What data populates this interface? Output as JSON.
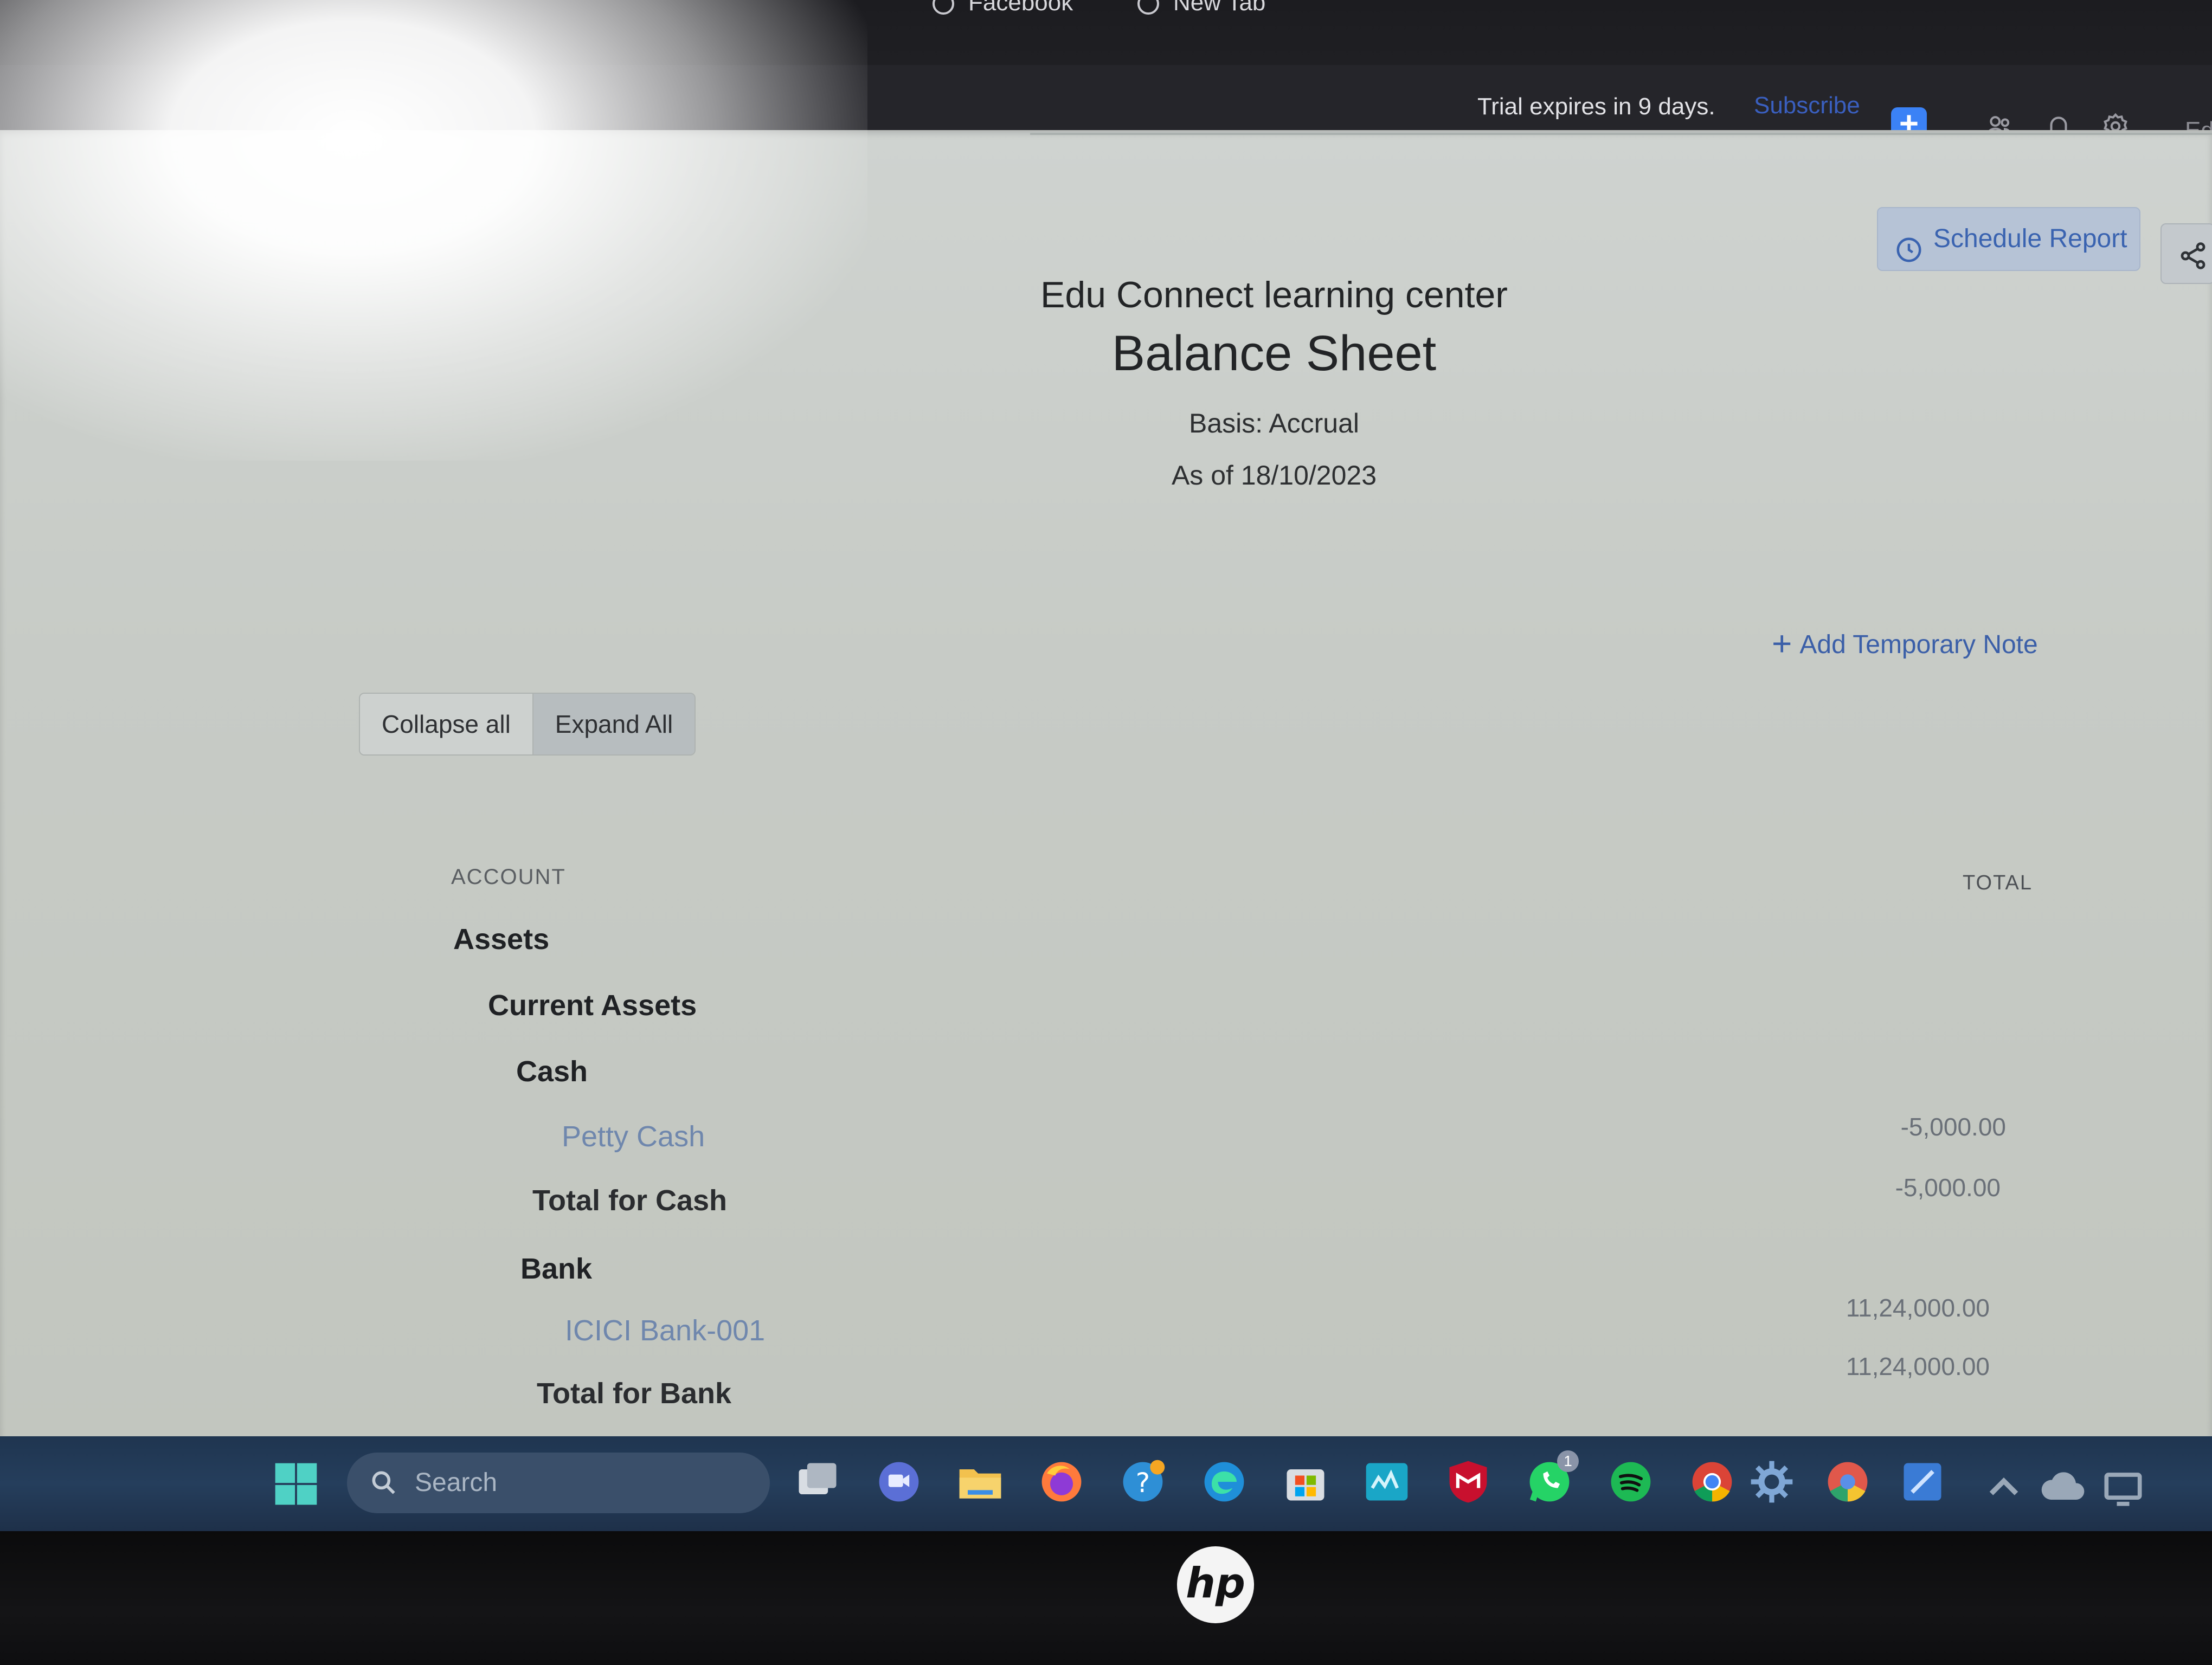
{
  "browser": {
    "tabs": [
      {
        "label": "Facebook"
      },
      {
        "label": "New Tab"
      }
    ]
  },
  "topbar": {
    "trial_text": "Trial expires in 9 days.",
    "subscribe_label": "Subscribe",
    "quick_create_label": "+",
    "org_initial": "Ed",
    "icons": [
      "users-icon",
      "bell-icon",
      "gear-icon"
    ]
  },
  "toolbar": {
    "schedule_label": "Schedule Report",
    "share_icon": "share-icon"
  },
  "report": {
    "org_name": "Edu Connect learning center",
    "title": "Balance Sheet",
    "basis": "Basis: Accrual",
    "as_of": "As of 18/10/2023",
    "add_note_label": "Add Temporary Note",
    "collapse_label": "Collapse all",
    "expand_label": "Expand All",
    "columns": {
      "account": "ACCOUNT",
      "total": "TOTAL"
    },
    "rows": [
      {
        "label": "Assets",
        "amount": ""
      },
      {
        "label": "Current Assets",
        "amount": ""
      },
      {
        "label": "Cash",
        "amount": ""
      },
      {
        "label": "Petty Cash",
        "amount": "-5,000.00"
      },
      {
        "label": "Total for Cash",
        "amount": "-5,000.00"
      },
      {
        "label": "Bank",
        "amount": ""
      },
      {
        "label": "ICICI Bank-001",
        "amount": "11,24,000.00"
      },
      {
        "label": "Total for Bank",
        "amount": "11,24,000.00"
      }
    ]
  },
  "taskbar": {
    "search_placeholder": "Search",
    "apps": [
      "task-view",
      "teams-chat",
      "file-explorer",
      "firefox",
      "help",
      "edge",
      "microsoft-store",
      "mylo",
      "mcafee",
      "whatsapp",
      "spotify",
      "chrome",
      "settings",
      "chrome-profile",
      "app"
    ],
    "whatsapp_badge": "1"
  },
  "device": {
    "brand_logo": "hp"
  }
}
